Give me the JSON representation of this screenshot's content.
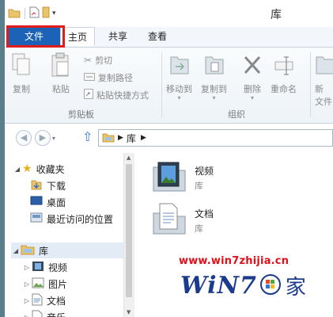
{
  "window": {
    "title": "库"
  },
  "tabs": [
    {
      "label": "文件"
    },
    {
      "label": "主页"
    },
    {
      "label": "共享"
    },
    {
      "label": "查看"
    }
  ],
  "ribbon": {
    "copy": "复制",
    "paste": "粘贴",
    "cut": "剪切",
    "copy_path": "复制路径",
    "paste_shortcut": "粘贴快捷方式",
    "clipboard_group": "剪贴板",
    "move_to": "移动到",
    "copy_to": "复制到",
    "delete": "删除",
    "rename": "重命名",
    "new_folder": "新建\n文件",
    "organize_group": "组织",
    "new_folder_line1": "新",
    "new_folder_line2": "文件"
  },
  "address": {
    "crumbs": [
      "库"
    ]
  },
  "nav": {
    "favorites": "收藏夹",
    "downloads": "下载",
    "desktop": "桌面",
    "recent": "最近访问的位置",
    "libraries": "库",
    "videos": "视频",
    "pictures": "图片",
    "documents": "文档",
    "music": "音乐"
  },
  "content": [
    {
      "name": "视频",
      "sub": "库"
    },
    {
      "name": "文档",
      "sub": "库"
    }
  ],
  "watermark": {
    "url": "www.win7zhijia.cn",
    "logo_text": "WiN7",
    "logo_suffix": "家"
  }
}
